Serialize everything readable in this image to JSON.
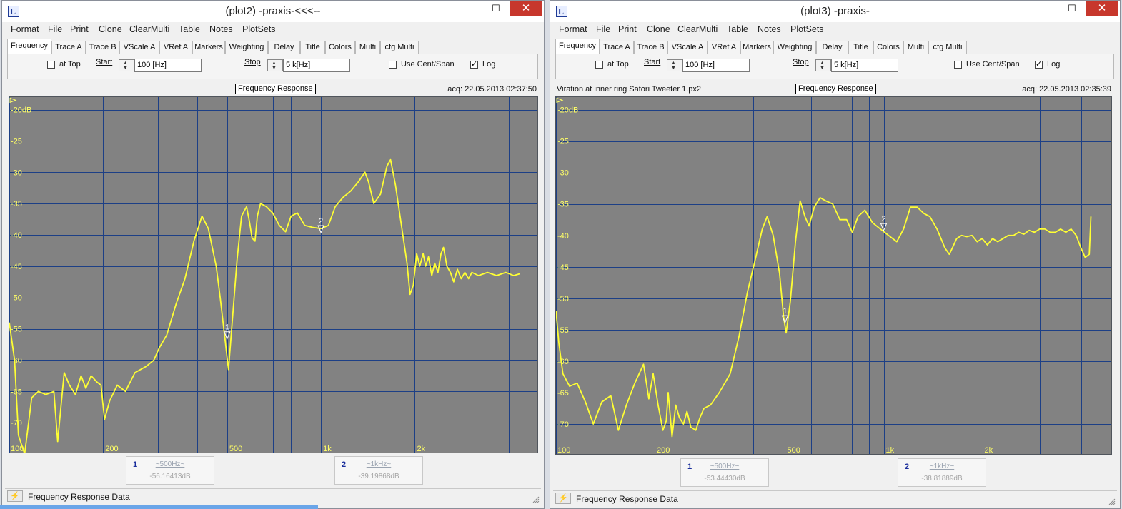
{
  "windows": [
    {
      "id": "plot2",
      "title": "(plot2) -praxis-<<<--",
      "info_left": "",
      "info_title": "Frequency Response",
      "info_right": "acq: 22.05.2013 02:37:50",
      "markers": [
        {
          "num": "1",
          "freq": "~500Hz~",
          "value": "-56.16413dB"
        },
        {
          "num": "2",
          "freq": "~1kHz~",
          "value": "-39.19868dB"
        }
      ],
      "status": "Frequency Response Data"
    },
    {
      "id": "plot3",
      "title": "(plot3) -praxis-",
      "info_left": "Viration at inner ring Satori Tweeter 1.px2",
      "info_title": "Frequency Response",
      "info_right": "acq: 22.05.2013 02:35:39",
      "markers": [
        {
          "num": "1",
          "freq": "~500Hz~",
          "value": "-53.44430dB"
        },
        {
          "num": "2",
          "freq": "~1kHz~",
          "value": "-38.81889dB"
        }
      ],
      "status": "Frequency Response Data"
    }
  ],
  "window_buttons": {
    "minimize": "—",
    "maximize": "☐",
    "close": "✕"
  },
  "menu": [
    "Format",
    "File",
    "Print",
    "Clone",
    "ClearMulti",
    "Table",
    "Notes",
    "PlotSets"
  ],
  "tabs": [
    "Frequency",
    "Trace A",
    "Trace B",
    "VScale A",
    "VRef A",
    "Markers",
    "Weighting",
    "Delay",
    "Title",
    "Colors",
    "Multi",
    "cfg Multi"
  ],
  "controls": {
    "at_top_label": "at Top",
    "at_top_checked": false,
    "start_label": "Start",
    "start_value": "100 [Hz]",
    "stop_label": "Stop",
    "stop_value": "5 k[Hz]",
    "use_cent_span_label": "Use Cent/Span",
    "use_cent_span_checked": false,
    "log_label": "Log",
    "log_checked": true,
    "check_mark": "✓"
  },
  "icons": {
    "app": "L",
    "status": "⚡"
  },
  "colors": {
    "plot_bg": "#828282",
    "grid": "#1c3f86",
    "trace": "#ffff33",
    "label": "#ffff66"
  },
  "chart_data": [
    {
      "type": "line",
      "title": "Frequency Response",
      "x_scale": "log",
      "xlim": [
        100,
        5000
      ],
      "ylim": [
        -75,
        -18
      ],
      "grid": true,
      "x_tick_labels": [
        {
          "x": 100,
          "label": "100"
        },
        {
          "x": 200,
          "label": "200"
        },
        {
          "x": 500,
          "label": "500"
        },
        {
          "x": 1000,
          "label": "1k"
        },
        {
          "x": 2000,
          "label": "2k"
        }
      ],
      "y_tick_labels": [
        {
          "y": -20,
          "label": "-20dB"
        },
        {
          "y": -25,
          "label": "-25"
        },
        {
          "y": -30,
          "label": "-30"
        },
        {
          "y": -35,
          "label": "-35"
        },
        {
          "y": -40,
          "label": "-40"
        },
        {
          "y": -45,
          "label": "-45"
        },
        {
          "y": -50,
          "label": "-50"
        },
        {
          "y": -55,
          "label": "-55"
        },
        {
          "y": -60,
          "label": "-60"
        },
        {
          "y": -65,
          "label": "-65"
        },
        {
          "y": -70,
          "label": "-70"
        }
      ],
      "markers": [
        {
          "label": "1",
          "x": 500,
          "y": -56.16
        },
        {
          "label": "2",
          "x": 1000,
          "y": -39.2
        }
      ],
      "series": [
        {
          "points": [
            [
              100,
              -54
            ],
            [
              104,
              -60
            ],
            [
              107,
              -72
            ],
            [
              112,
              -75
            ],
            [
              118,
              -66
            ],
            [
              124,
              -65
            ],
            [
              131,
              -65.5
            ],
            [
              139,
              -65
            ],
            [
              143,
              -73
            ],
            [
              150,
              -62
            ],
            [
              156,
              -64
            ],
            [
              163,
              -65.5
            ],
            [
              170,
              -62.5
            ],
            [
              176,
              -64.5
            ],
            [
              183,
              -62.5
            ],
            [
              191,
              -63.5
            ],
            [
              197,
              -64
            ],
            [
              202,
              -69.5
            ],
            [
              210,
              -66.5
            ],
            [
              222,
              -64
            ],
            [
              236,
              -65
            ],
            [
              253,
              -62
            ],
            [
              275,
              -61
            ],
            [
              291,
              -60
            ],
            [
              303,
              -58
            ],
            [
              320,
              -56
            ],
            [
              343,
              -51
            ],
            [
              366,
              -47
            ],
            [
              391,
              -41
            ],
            [
              415,
              -37
            ],
            [
              435,
              -39
            ],
            [
              461,
              -45
            ],
            [
              475,
              -50
            ],
            [
              493,
              -57
            ],
            [
              505,
              -61.5
            ],
            [
              515,
              -56
            ],
            [
              538,
              -44
            ],
            [
              556,
              -37
            ],
            [
              577,
              -35.5
            ],
            [
              590,
              -38
            ],
            [
              601,
              -40.5
            ],
            [
              614,
              -41
            ],
            [
              625,
              -37
            ],
            [
              640,
              -35
            ],
            [
              668,
              -35.5
            ],
            [
              700,
              -36.5
            ],
            [
              735,
              -38.5
            ],
            [
              770,
              -39.5
            ],
            [
              802,
              -37
            ],
            [
              840,
              -36.5
            ],
            [
              887,
              -38.5
            ],
            [
              940,
              -38.8
            ],
            [
              1000,
              -39
            ],
            [
              1056,
              -38.5
            ],
            [
              1111,
              -35.5
            ],
            [
              1177,
              -34
            ],
            [
              1246,
              -33
            ],
            [
              1320,
              -31.5
            ],
            [
              1384,
              -30
            ],
            [
              1420,
              -31.5
            ],
            [
              1478,
              -35
            ],
            [
              1552,
              -33.5
            ],
            [
              1629,
              -29
            ],
            [
              1672,
              -28
            ],
            [
              1733,
              -32
            ],
            [
              1818,
              -39
            ],
            [
              1888,
              -44.5
            ],
            [
              1931,
              -49.5
            ],
            [
              1979,
              -48
            ],
            [
              2028,
              -43
            ],
            [
              2075,
              -45
            ],
            [
              2127,
              -43
            ],
            [
              2167,
              -45
            ],
            [
              2213,
              -43.5
            ],
            [
              2267,
              -46.5
            ],
            [
              2317,
              -44.5
            ],
            [
              2372,
              -46
            ],
            [
              2427,
              -43
            ],
            [
              2473,
              -42
            ],
            [
              2534,
              -45
            ],
            [
              2602,
              -46
            ],
            [
              2666,
              -47.5
            ],
            [
              2740,
              -45.5
            ],
            [
              2816,
              -47
            ],
            [
              2895,
              -46
            ],
            [
              2976,
              -47
            ],
            [
              3049,
              -46
            ],
            [
              3200,
              -46.5
            ],
            [
              3420,
              -46
            ],
            [
              3660,
              -46.5
            ],
            [
              3916,
              -46
            ],
            [
              4152,
              -46.5
            ],
            [
              4351,
              -46.2
            ]
          ]
        }
      ]
    },
    {
      "type": "line",
      "title": "Frequency Response",
      "x_scale": "log",
      "xlim": [
        100,
        5000
      ],
      "ylim": [
        -75,
        -18
      ],
      "grid": true,
      "x_tick_labels": [
        {
          "x": 100,
          "label": "100"
        },
        {
          "x": 200,
          "label": "200"
        },
        {
          "x": 500,
          "label": "500"
        },
        {
          "x": 1000,
          "label": "1k"
        },
        {
          "x": 2000,
          "label": "2k"
        }
      ],
      "y_tick_labels": [
        {
          "y": -20,
          "label": "-20dB"
        },
        {
          "y": -25,
          "label": "-25"
        },
        {
          "y": -30,
          "label": "-30"
        },
        {
          "y": -35,
          "label": "-35"
        },
        {
          "y": -40,
          "label": "-40"
        },
        {
          "y": -45,
          "label": "-45"
        },
        {
          "y": -50,
          "label": "-50"
        },
        {
          "y": -55,
          "label": "-55"
        },
        {
          "y": -60,
          "label": "-60"
        },
        {
          "y": -65,
          "label": "-65"
        },
        {
          "y": -70,
          "label": "-70"
        }
      ],
      "markers": [
        {
          "label": "1",
          "x": 500,
          "y": -53.44
        },
        {
          "label": "2",
          "x": 1000,
          "y": -38.8
        }
      ],
      "series": [
        {
          "points": [
            [
              100,
              -52
            ],
            [
              102,
              -57
            ],
            [
              105,
              -62
            ],
            [
              110,
              -64
            ],
            [
              116,
              -63.5
            ],
            [
              123,
              -66.5
            ],
            [
              130,
              -70
            ],
            [
              138,
              -66.5
            ],
            [
              147,
              -65.5
            ],
            [
              155,
              -71
            ],
            [
              164,
              -67
            ],
            [
              174,
              -63.5
            ],
            [
              185,
              -60.5
            ],
            [
              192,
              -66
            ],
            [
              198,
              -62
            ],
            [
              205,
              -67
            ],
            [
              212,
              -71
            ],
            [
              217,
              -69.5
            ],
            [
              220,
              -65
            ],
            [
              226,
              -72
            ],
            [
              232,
              -67
            ],
            [
              238,
              -69
            ],
            [
              245,
              -70
            ],
            [
              251,
              -68
            ],
            [
              258,
              -70.5
            ],
            [
              267,
              -71
            ],
            [
              275,
              -69
            ],
            [
              283,
              -67.5
            ],
            [
              296,
              -67
            ],
            [
              315,
              -65
            ],
            [
              340,
              -62
            ],
            [
              362,
              -56
            ],
            [
              384,
              -49
            ],
            [
              405,
              -44
            ],
            [
              426,
              -39
            ],
            [
              441,
              -37
            ],
            [
              460,
              -40
            ],
            [
              481,
              -46
            ],
            [
              495,
              -53
            ],
            [
              504,
              -55.5
            ],
            [
              519,
              -50.5
            ],
            [
              538,
              -41
            ],
            [
              556,
              -34.5
            ],
            [
              575,
              -37
            ],
            [
              592,
              -38.5
            ],
            [
              614,
              -35.5
            ],
            [
              640,
              -34
            ],
            [
              665,
              -34.5
            ],
            [
              699,
              -35
            ],
            [
              735,
              -37.5
            ],
            [
              771,
              -37.5
            ],
            [
              802,
              -39.5
            ],
            [
              835,
              -37
            ],
            [
              876,
              -36
            ],
            [
              925,
              -38
            ],
            [
              978,
              -39
            ],
            [
              1035,
              -40
            ],
            [
              1097,
              -41
            ],
            [
              1150,
              -39
            ],
            [
              1207,
              -35.5
            ],
            [
              1265,
              -35.5
            ],
            [
              1325,
              -36.5
            ],
            [
              1383,
              -37
            ],
            [
              1455,
              -39
            ],
            [
              1538,
              -42
            ],
            [
              1586,
              -43
            ],
            [
              1620,
              -42
            ],
            [
              1670,
              -40.5
            ],
            [
              1729,
              -40
            ],
            [
              1794,
              -40.2
            ],
            [
              1860,
              -40
            ],
            [
              1929,
              -41
            ],
            [
              1998,
              -40.5
            ],
            [
              2072,
              -41.5
            ],
            [
              2149,
              -40.5
            ],
            [
              2230,
              -41
            ],
            [
              2312,
              -40.5
            ],
            [
              2400,
              -40
            ],
            [
              2490,
              -40
            ],
            [
              2582,
              -39.5
            ],
            [
              2679,
              -39.8
            ],
            [
              2780,
              -39.2
            ],
            [
              2884,
              -39.5
            ],
            [
              2992,
              -39
            ],
            [
              3104,
              -39
            ],
            [
              3220,
              -39.5
            ],
            [
              3341,
              -39.5
            ],
            [
              3467,
              -39
            ],
            [
              3597,
              -39.5
            ],
            [
              3732,
              -39
            ],
            [
              3868,
              -40
            ],
            [
              4000,
              -42
            ],
            [
              4120,
              -43.5
            ],
            [
              4240,
              -43
            ],
            [
              4290,
              -37
            ]
          ]
        }
      ]
    }
  ]
}
